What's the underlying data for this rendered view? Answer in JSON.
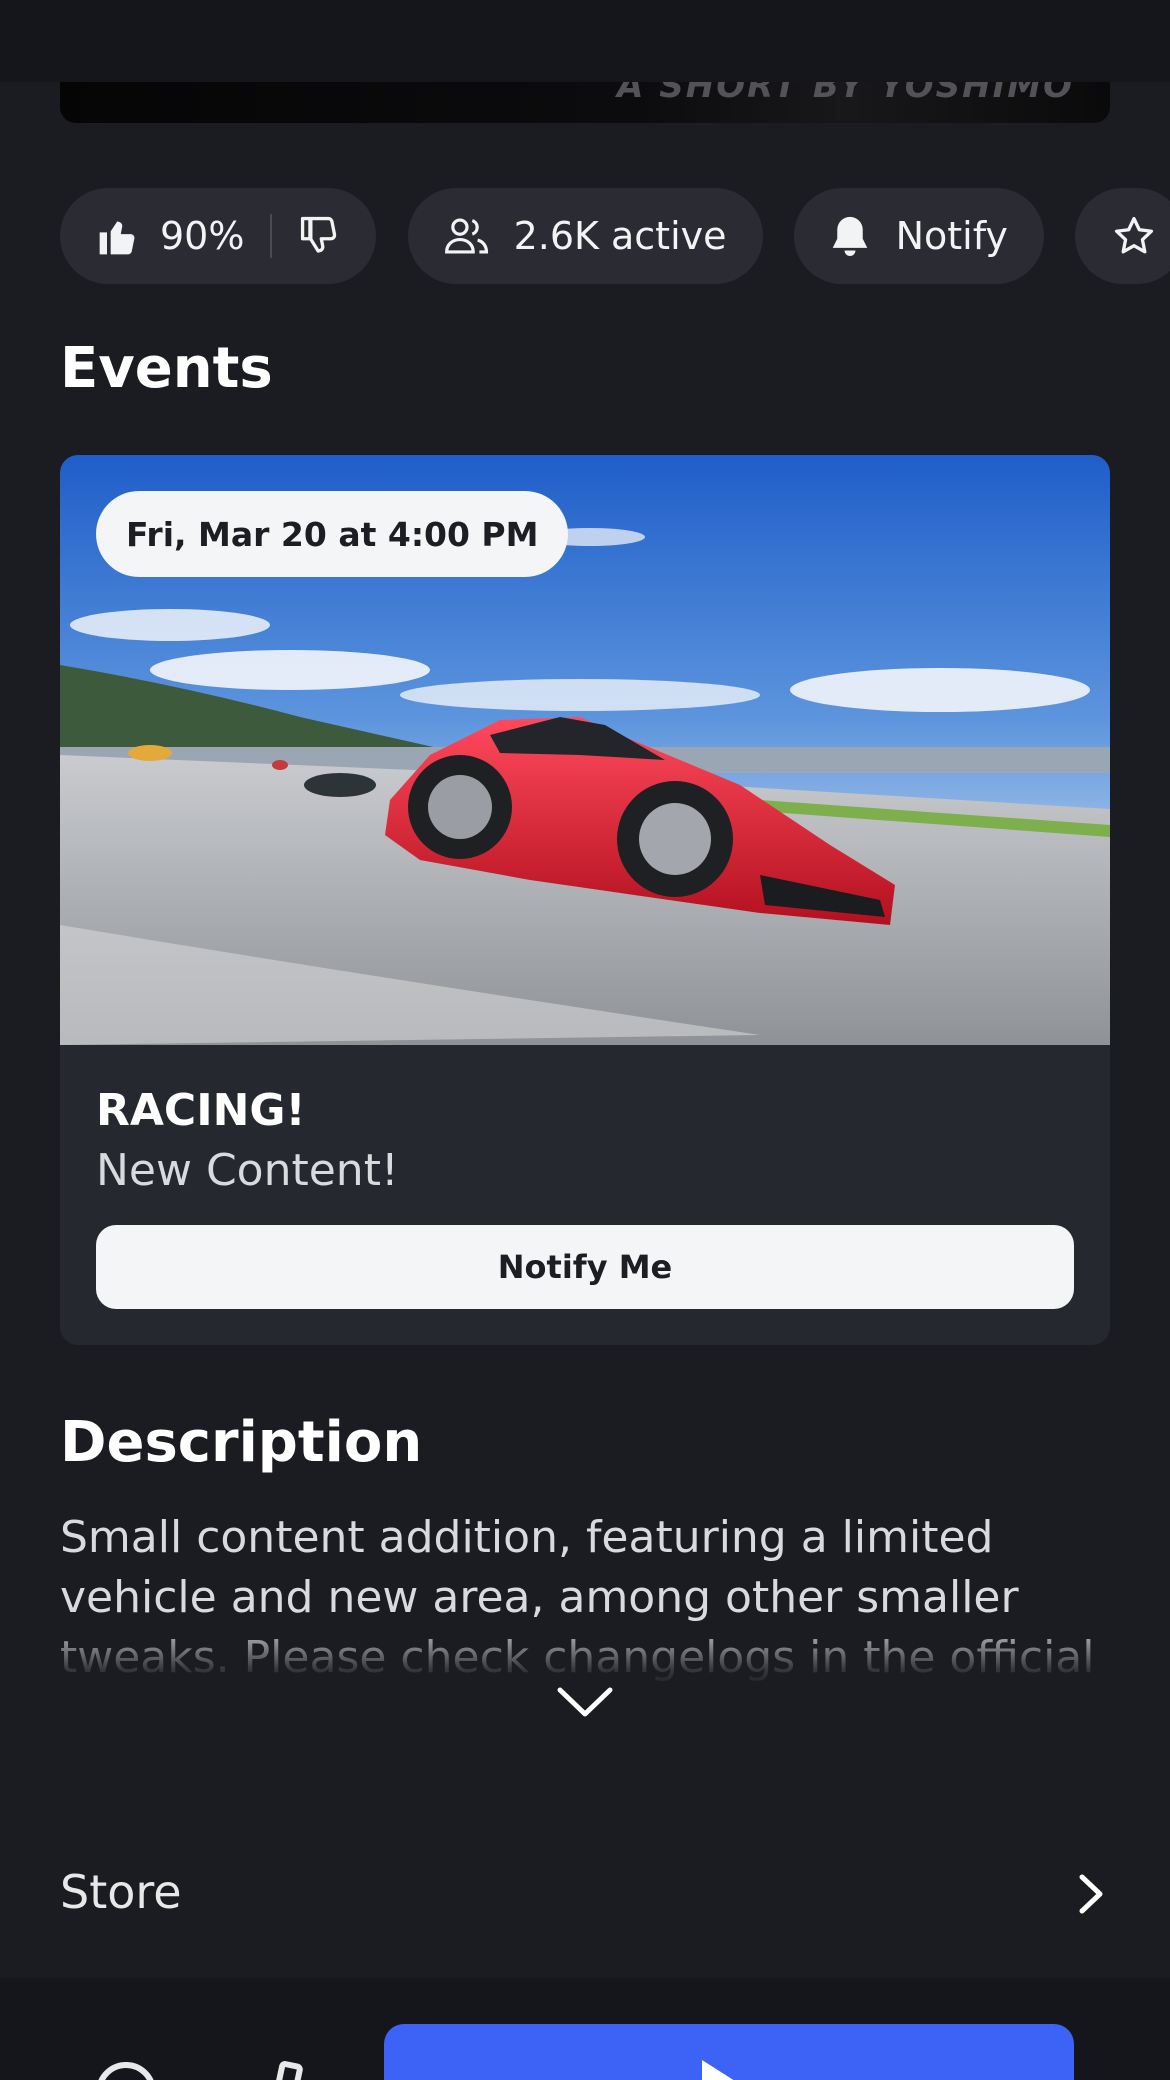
{
  "hero": {
    "caption": "A SHORT BY YOSHIMO"
  },
  "chips": {
    "rating": {
      "value": "90%"
    },
    "active": {
      "label": "2.6K active"
    },
    "notify": {
      "label": "Notify"
    }
  },
  "events": {
    "title": "Events",
    "items": [
      {
        "date": "Fri, Mar 20 at 4:00 PM",
        "name": "RACING!",
        "subtitle": "New Content!",
        "action": "Notify Me"
      }
    ]
  },
  "description": {
    "title": "Description",
    "text": "Small content addition, featuring a limited vehicle and new area, among other smaller tweaks. Please check changelogs in the official"
  },
  "store": {
    "label": "Store"
  },
  "colors": {
    "accent": "#3c63f5",
    "background": "#1b1c21",
    "card": "#262830"
  },
  "icons": [
    "thumbs-up-icon",
    "thumbs-down-icon",
    "users-icon",
    "bell-icon",
    "star-icon",
    "chevron-down-icon",
    "chevron-right-icon",
    "play-icon"
  ]
}
